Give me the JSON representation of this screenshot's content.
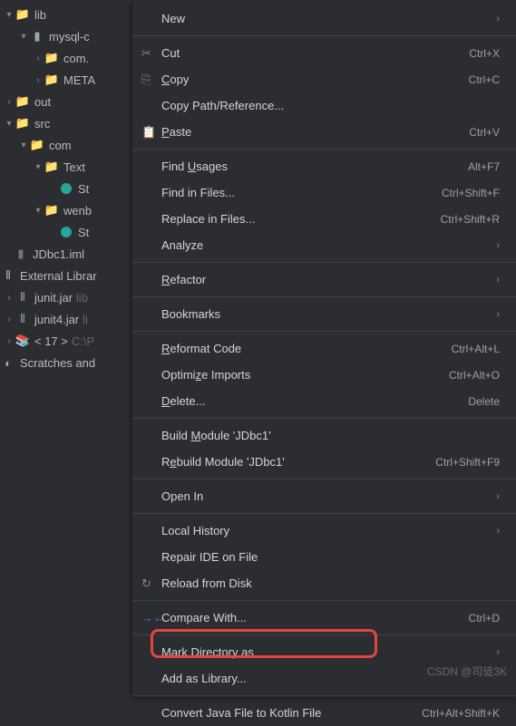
{
  "tree": {
    "lib": "lib",
    "mysql": "mysql-c",
    "com": "com.",
    "meta": "META",
    "out": "out",
    "src": "src",
    "src_com": "com",
    "text": "Text",
    "st1": "St",
    "wenb": "wenb",
    "st2": "St",
    "iml": "JDbc1.iml",
    "extlib": "External Librar",
    "junit": "junit.jar",
    "junit_suffix": "lib",
    "junit4": "junit4.jar",
    "junit4_suffix": "li",
    "jdk": "< 17 >",
    "jdk_path": "C:\\P",
    "scratches": "Scratches and"
  },
  "menu": {
    "new": "New",
    "cut": "Cut",
    "cut_sc": "Ctrl+X",
    "copy": "Copy",
    "copy_sc": "Ctrl+C",
    "copypath": "Copy Path/Reference...",
    "paste": "Paste",
    "paste_sc": "Ctrl+V",
    "findusages": "Find Usages",
    "findusages_sc": "Alt+F7",
    "findinfiles": "Find in Files...",
    "findinfiles_sc": "Ctrl+Shift+F",
    "replaceinfiles": "Replace in Files...",
    "replaceinfiles_sc": "Ctrl+Shift+R",
    "analyze": "Analyze",
    "refactor": "Refactor",
    "bookmarks": "Bookmarks",
    "reformat": "Reformat Code",
    "reformat_sc": "Ctrl+Alt+L",
    "optimize": "Optimize Imports",
    "optimize_sc": "Ctrl+Alt+O",
    "delete": "Delete...",
    "delete_sc": "Delete",
    "buildmodule": "Build Module 'JDbc1'",
    "rebuildmodule": "Rebuild Module 'JDbc1'",
    "rebuild_sc": "Ctrl+Shift+F9",
    "openin": "Open In",
    "localhistory": "Local History",
    "repairide": "Repair IDE on File",
    "reload": "Reload from Disk",
    "compare": "Compare With...",
    "compare_sc": "Ctrl+D",
    "markdir": "Mark Directory as",
    "addlib": "Add as Library...",
    "convert": "Convert Java File to Kotlin File",
    "convert_sc": "Ctrl+Alt+Shift+K"
  },
  "watermark": "CSDN @司徒3K"
}
